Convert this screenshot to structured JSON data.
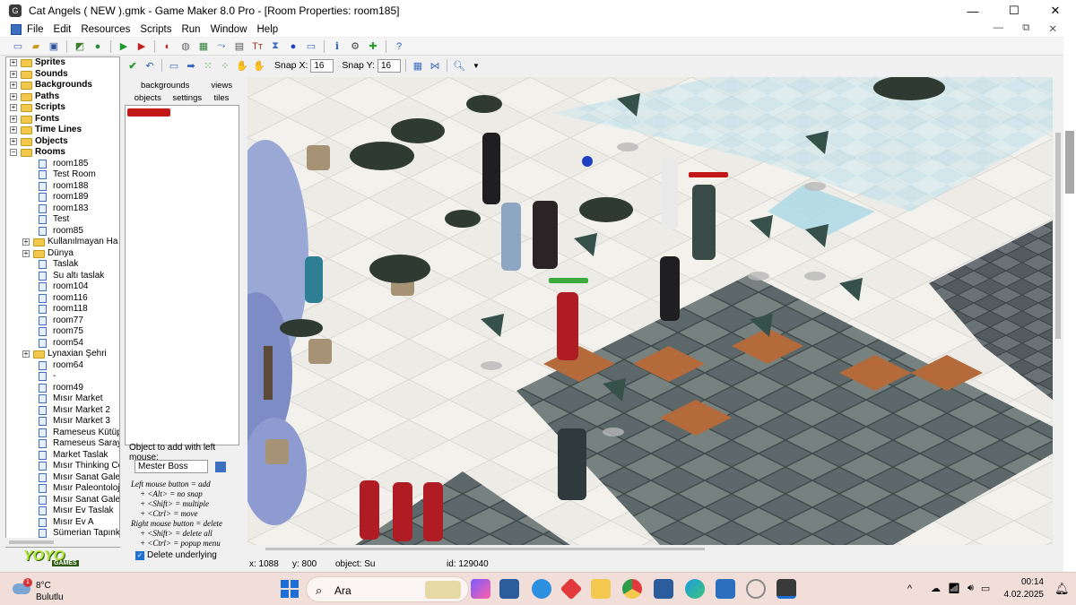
{
  "window": {
    "title": "Cat Angels ( NEW ).gmk - Game Maker 8.0 Pro - [Room Properties: room185]",
    "minimize": "—",
    "maximize": "☐",
    "close": "✕"
  },
  "menu": [
    "File",
    "Edit",
    "Resources",
    "Scripts",
    "Run",
    "Window",
    "Help"
  ],
  "mdi_controls": [
    "—",
    "⧉",
    "✕"
  ],
  "resource_tree": [
    {
      "label": "Sprites",
      "type": "folder",
      "bold": true
    },
    {
      "label": "Sounds",
      "type": "folder",
      "bold": true
    },
    {
      "label": "Backgrounds",
      "type": "folder",
      "bold": true
    },
    {
      "label": "Paths",
      "type": "folder",
      "bold": true
    },
    {
      "label": "Scripts",
      "type": "folder",
      "bold": true
    },
    {
      "label": "Fonts",
      "type": "folder",
      "bold": true
    },
    {
      "label": "Time Lines",
      "type": "folder",
      "bold": true
    },
    {
      "label": "Objects",
      "type": "folder",
      "bold": true
    },
    {
      "label": "Rooms",
      "type": "folder",
      "bold": true
    },
    {
      "label": "room185",
      "type": "room"
    },
    {
      "label": "Test Room",
      "type": "room"
    },
    {
      "label": "room188",
      "type": "room"
    },
    {
      "label": "room189",
      "type": "room"
    },
    {
      "label": "room183",
      "type": "room"
    },
    {
      "label": "Test",
      "type": "room"
    },
    {
      "label": "room85",
      "type": "room"
    },
    {
      "label": "Kullanılmayan Ha",
      "type": "subfolder"
    },
    {
      "label": "Dünya",
      "type": "subfolder"
    },
    {
      "label": "Taslak",
      "type": "room"
    },
    {
      "label": "Su altı taslak",
      "type": "room"
    },
    {
      "label": "room104",
      "type": "room"
    },
    {
      "label": "room116",
      "type": "room"
    },
    {
      "label": "room118",
      "type": "room"
    },
    {
      "label": "room77",
      "type": "room"
    },
    {
      "label": "room75",
      "type": "room"
    },
    {
      "label": "room54",
      "type": "room"
    },
    {
      "label": "Lynaxian Şehri",
      "type": "subfolder"
    },
    {
      "label": "room64",
      "type": "room"
    },
    {
      "label": "-",
      "type": "room"
    },
    {
      "label": "room49",
      "type": "room"
    },
    {
      "label": "Mısır Market",
      "type": "room"
    },
    {
      "label": "Mısır Market 2",
      "type": "room"
    },
    {
      "label": "Mısır Market 3",
      "type": "room"
    },
    {
      "label": "Rameseus Kütüp",
      "type": "room"
    },
    {
      "label": "Rameseus Saray",
      "type": "room"
    },
    {
      "label": "Market Taslak",
      "type": "room"
    },
    {
      "label": "Mısır Thinking Co",
      "type": "room"
    },
    {
      "label": "Mısır Sanat Gale",
      "type": "room"
    },
    {
      "label": "Mısır Paleontoloji",
      "type": "room"
    },
    {
      "label": "Mısır Sanat Gale",
      "type": "room"
    },
    {
      "label": "Mısır Ev Taslak",
      "type": "room"
    },
    {
      "label": "Mısır Ev A",
      "type": "room"
    },
    {
      "label": "Sümerian Tapınk",
      "type": "room"
    }
  ],
  "logo": {
    "main": "YOYO",
    "sub": "GAMES"
  },
  "room_toolbar": {
    "snap_x_label": "Snap X:",
    "snap_x": "16",
    "snap_y_label": "Snap Y:",
    "snap_y": "16"
  },
  "tabs": {
    "row1": [
      "backgrounds",
      "views"
    ],
    "row2": [
      "objects",
      "settings",
      "tiles"
    ]
  },
  "object_panel": {
    "add_label": "Object to add with left mouse:",
    "object_name": "Mester Boss",
    "help": [
      "Left mouse button = add",
      "+ <Alt> = no snap",
      "+ <Shift> = multiple",
      "+ <Ctrl> = move",
      "Right mouse button = delete",
      "+ <Shift> = delete all",
      "+ <Ctrl> = popup menu"
    ],
    "delete_underlying": "Delete underlying"
  },
  "status": {
    "x": "x: 1088",
    "y": "y: 800",
    "object": "object: Su",
    "id": "id: 129040"
  },
  "taskbar": {
    "temp": "8°C",
    "condition": "Bulutlu",
    "weather_badge": "1",
    "search_placeholder": "Ara",
    "time": "00:14",
    "date": "4.02.2025",
    "tray_caret": "^"
  },
  "colors": {
    "accent": "#1d6fd6",
    "tile_stone": "#6f7a7c",
    "rust_tile": "#b56a3c",
    "snow": "#ecebe6",
    "ice": "#a9d8e6"
  }
}
